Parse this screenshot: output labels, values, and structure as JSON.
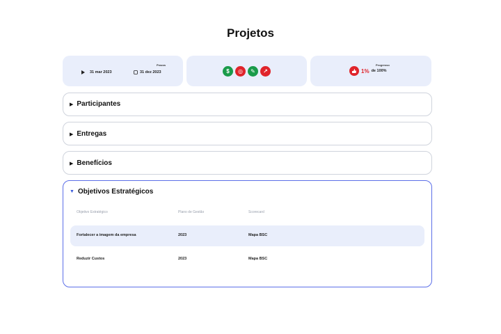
{
  "page": {
    "title": "Projetos"
  },
  "dates": {
    "label": "Prazos",
    "start": "31 mar 2023",
    "end": "31 dez 2023"
  },
  "icons": [
    {
      "name": "dollar-icon",
      "glyph": "$",
      "color": "#1a9b4a"
    },
    {
      "name": "target-icon",
      "glyph": "◎",
      "color": "#e0242b"
    },
    {
      "name": "leaf-icon",
      "glyph": "✎",
      "color": "#1a9b4a"
    },
    {
      "name": "trend-icon",
      "glyph": "↗",
      "color": "#e0242b"
    }
  ],
  "progress": {
    "label": "Progresso",
    "percent": "1%",
    "of_label": "de 100%",
    "icon_color": "#e0242b"
  },
  "sections": {
    "participants": "Participantes",
    "deliverables": "Entregas",
    "benefits": "Benefícios",
    "objectives": "Objetivos Estratégicos"
  },
  "objectives_table": {
    "headers": [
      "Objetivo Estratégico",
      "Plano de Gestão",
      "Scorecard"
    ],
    "rows": [
      [
        "Fortalecer a imagem da empresa",
        "2023",
        "Mapa BSC"
      ],
      [
        "Reduzir Custos",
        "2023",
        "Mapa BSC"
      ]
    ]
  }
}
